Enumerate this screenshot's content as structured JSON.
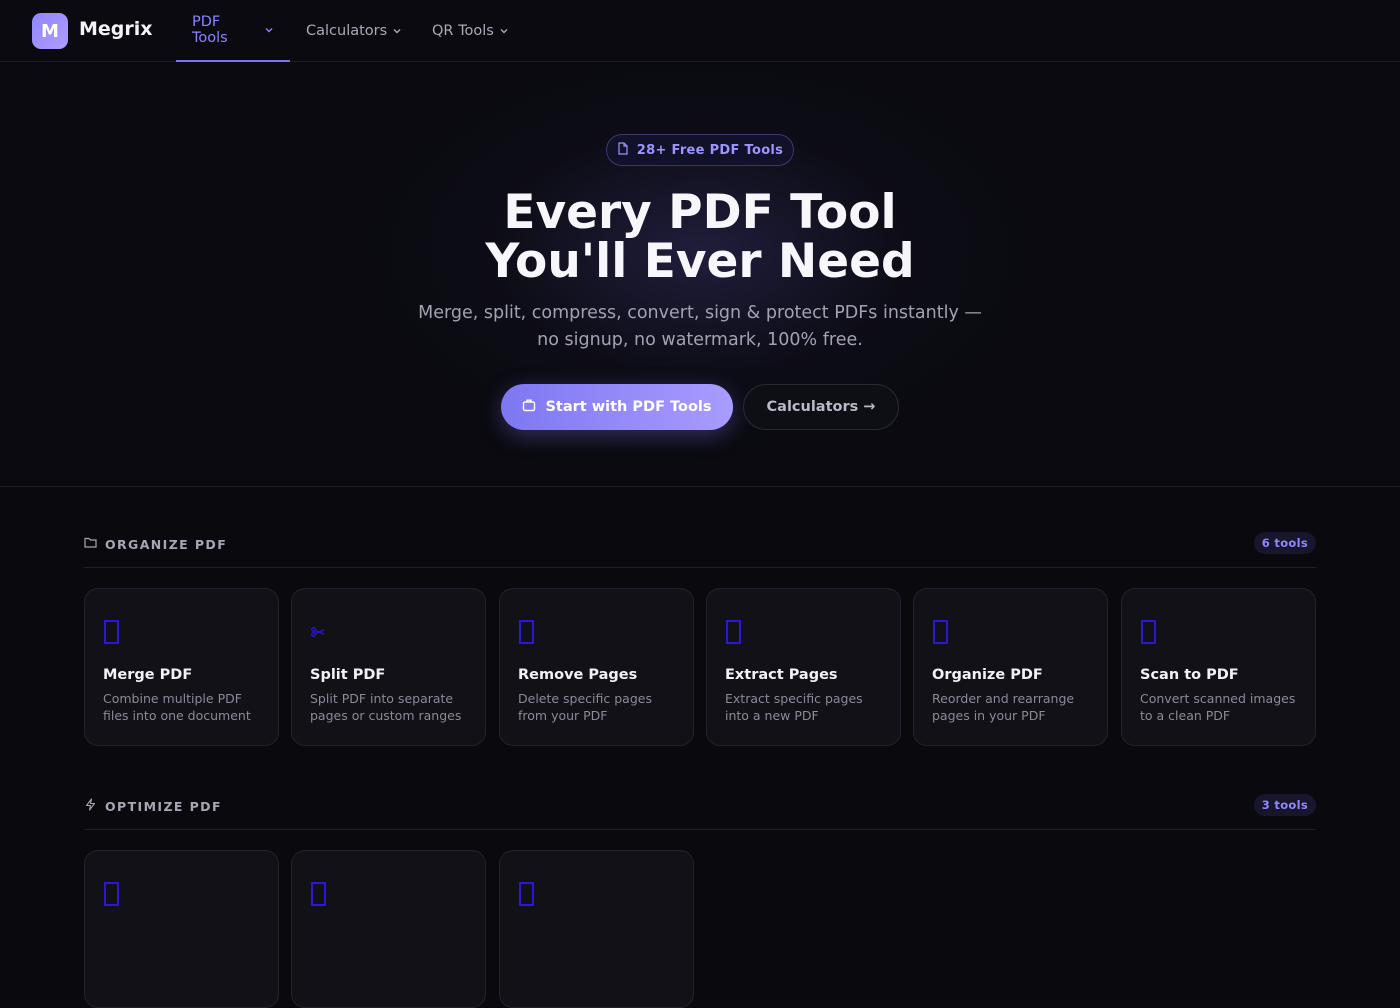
{
  "brand": {
    "initial": "M",
    "name": "Megrix"
  },
  "nav": {
    "tabs": [
      {
        "label": "PDF Tools",
        "active": true
      },
      {
        "label": "Calculators",
        "active": false
      },
      {
        "label": "QR Tools",
        "active": false
      }
    ]
  },
  "hero": {
    "pill": "28+ Free PDF Tools",
    "title_line1": "Every PDF Tool",
    "title_line2": "You'll Ever Need",
    "subtitle_line1": "Merge, split, compress, convert, sign & protect PDFs instantly —",
    "subtitle_line2": "no signup, no watermark, 100% free.",
    "primary_button": "Start with PDF Tools",
    "secondary_button": "Calculators →"
  },
  "sections": [
    {
      "title": "ORGANIZE PDF",
      "icon": "folder-icon",
      "count": "6 tools",
      "tools": [
        {
          "name": "Merge PDF",
          "desc": "Combine multiple PDF files into one document",
          "icon": "merge-icon"
        },
        {
          "name": "Split PDF",
          "desc": "Split PDF into separate pages or custom ranges",
          "icon": "scissors-icon"
        },
        {
          "name": "Remove Pages",
          "desc": "Delete specific pages from your PDF",
          "icon": "remove-pages-icon"
        },
        {
          "name": "Extract Pages",
          "desc": "Extract specific pages into a new PDF",
          "icon": "extract-icon"
        },
        {
          "name": "Organize PDF",
          "desc": "Reorder and rearrange pages in your PDF",
          "icon": "organize-icon"
        },
        {
          "name": "Scan to PDF",
          "desc": "Convert scanned images to a clean PDF",
          "icon": "scan-icon"
        }
      ]
    },
    {
      "title": "OPTIMIZE PDF",
      "icon": "lightning-icon",
      "count": "3 tools"
    }
  ],
  "colors": {
    "accent": "#8b84ff",
    "background": "#09090e",
    "card": "#111117",
    "icon_fallback": "#2b17d6"
  }
}
